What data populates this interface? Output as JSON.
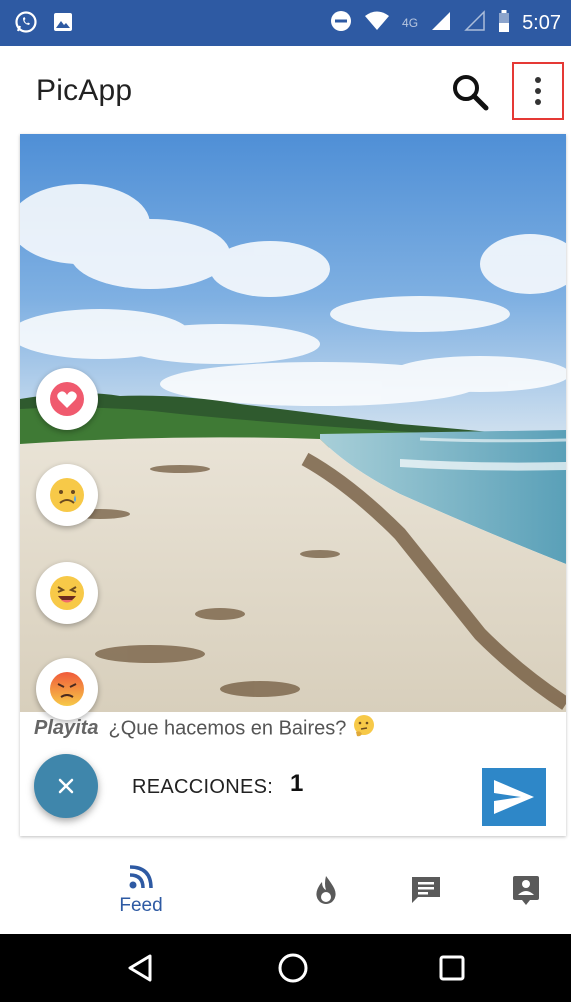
{
  "status_bar": {
    "time": "5:07",
    "network": "4G",
    "icons": [
      "whatsapp-icon",
      "gallery-icon",
      "do-not-disturb-icon",
      "wifi-icon",
      "signal-icon",
      "signal-empty-icon",
      "battery-icon"
    ]
  },
  "app_bar": {
    "title": "PicApp",
    "search_icon": "search-icon",
    "menu_icon": "more-vert-icon"
  },
  "post": {
    "username": "Playita",
    "caption": "¿Que hacemos en Baires?",
    "caption_emoji": "thinking-emoji",
    "reactions_label": "REACCIONES:",
    "reactions_count": "1",
    "reaction_options": [
      "heart-reaction",
      "sad-reaction",
      "laugh-reaction",
      "angry-reaction"
    ]
  },
  "bottom_nav": {
    "items": [
      {
        "label": "Feed",
        "icon": "rss-feed-icon",
        "active": true
      },
      {
        "label": "",
        "icon": "flame-icon",
        "active": false
      },
      {
        "label": "",
        "icon": "chat-icon",
        "active": false
      },
      {
        "label": "",
        "icon": "contact-icon",
        "active": false
      }
    ]
  },
  "colors": {
    "status_bar": "#2e5aa3",
    "fab": "#3f86ab",
    "send": "#2e87c8",
    "active_nav": "#2e5aa3",
    "highlight": "#e53935"
  }
}
